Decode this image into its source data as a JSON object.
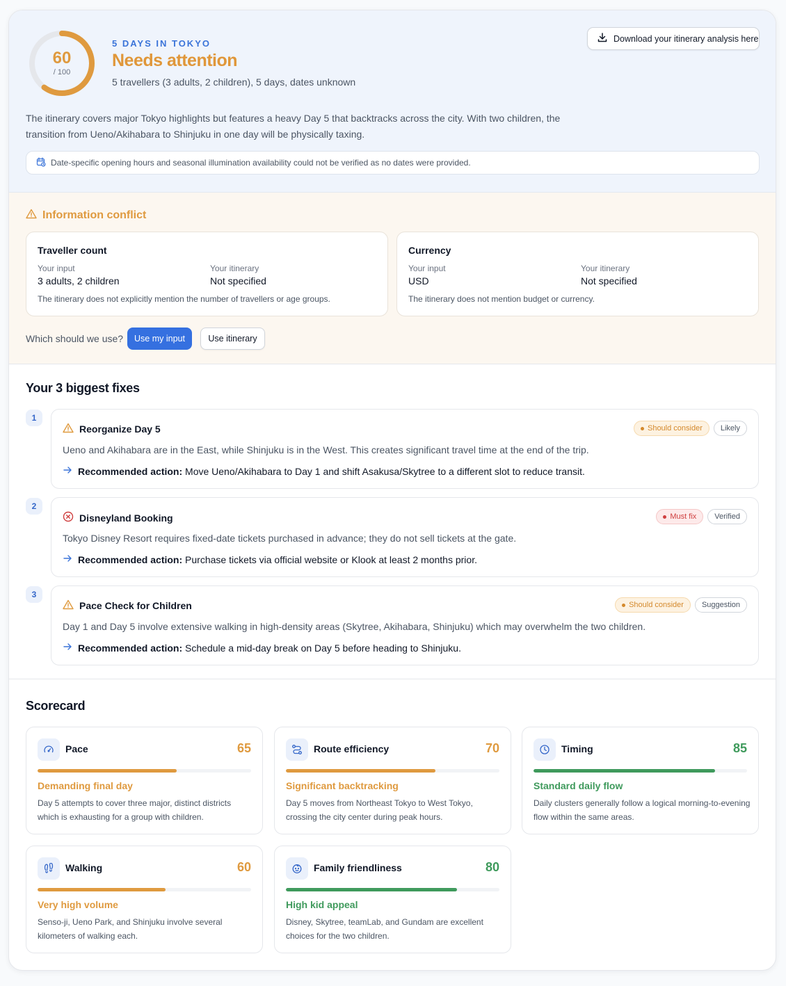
{
  "hero": {
    "score": "60",
    "score_value": 60,
    "score_out_of": "/ 100",
    "eyebrow": "5 DAYS IN TOKYO",
    "status": "Needs attention",
    "meta": "5 travellers (3 adults, 2 children), 5 days, dates unknown",
    "download_label": "Download your itinerary analysis here",
    "summary": "The itinerary covers major Tokyo highlights but features a heavy Day 5 that backtracks across the city. With two children, the transition from Ueno/Akihabara to Shinjuku in one day will be physically taxing.",
    "notice": "Date-specific opening hours and seasonal illumination availability could not be verified as no dates were provided.",
    "accent": "#df9a3f"
  },
  "conflict": {
    "title": "Information conflict",
    "boxes": [
      {
        "title": "Traveller count",
        "input_label": "Your input",
        "input_value": "3 adults, 2 children",
        "itinerary_label": "Your itinerary",
        "itinerary_value": "Not specified",
        "note": "The itinerary does not explicitly mention the number of travellers or age groups."
      },
      {
        "title": "Currency",
        "input_label": "Your input",
        "input_value": "USD",
        "itinerary_label": "Your itinerary",
        "itinerary_value": "Not specified",
        "note": "The itinerary does not mention budget or currency."
      }
    ],
    "question": "Which should we use?",
    "use_input_label": "Use my input",
    "use_itinerary_label": "Use itinerary"
  },
  "fixes": {
    "title": "Your 3 biggest fixes",
    "action_prefix": "Recommended action:",
    "items": [
      {
        "num": "1",
        "title": "Reorganize Day 5",
        "icon": "warning-icon",
        "severity": "Should consider",
        "confidence": "Likely",
        "body": "Ueno and Akihabara are in the East, while Shinjuku is in the West. This creates significant travel time at the end of the trip.",
        "action": "Move Ueno/Akihabara to Day 1 and shift Asakusa/Skytree to a different slot to reduce transit."
      },
      {
        "num": "2",
        "title": "Disneyland Booking",
        "icon": "error-icon",
        "severity": "Must fix",
        "confidence": "Verified",
        "body": "Tokyo Disney Resort requires fixed-date tickets purchased in advance; they do not sell tickets at the gate.",
        "action": "Purchase tickets via official website or Klook at least 2 months prior."
      },
      {
        "num": "3",
        "title": "Pace Check for Children",
        "icon": "warning-icon",
        "severity": "Should consider",
        "confidence": "Suggestion",
        "body": "Day 1 and Day 5 involve extensive walking in high-density areas (Skytree, Akihabara, Shinjuku) which may overwhelm the two children.",
        "action": "Schedule a mid-day break on Day 5 before heading to Shinjuku."
      }
    ]
  },
  "scorecard": {
    "title": "Scorecard",
    "items": [
      {
        "name": "Pace",
        "icon": "gauge-icon",
        "value": "65",
        "fill": 65,
        "color": "#df9a3f",
        "subtitle": "Demanding final day",
        "desc": "Day 5 attempts to cover three major, distinct districts which is exhausting for a group with children."
      },
      {
        "name": "Route efficiency",
        "icon": "route-icon",
        "value": "70",
        "fill": 70,
        "color": "#df9a3f",
        "subtitle": "Significant backtracking",
        "desc": "Day 5 moves from Northeast Tokyo to West Tokyo, crossing the city center during peak hours."
      },
      {
        "name": "Timing",
        "icon": "clock-icon",
        "value": "85",
        "fill": 85,
        "color": "#3f9a5c",
        "subtitle": "Standard daily flow",
        "desc": "Daily clusters generally follow a logical morning-to-evening flow within the same areas."
      },
      {
        "name": "Walking",
        "icon": "footprints-icon",
        "value": "60",
        "fill": 60,
        "color": "#df9a3f",
        "subtitle": "Very high volume",
        "desc": "Senso-ji, Ueno Park, and Shinjuku involve several kilometers of walking each."
      },
      {
        "name": "Family friendliness",
        "icon": "baby-face-icon",
        "value": "80",
        "fill": 80,
        "color": "#3f9a5c",
        "subtitle": "High kid appeal",
        "desc": "Disney, Skytree, teamLab, and Gundam are excellent choices for the two children."
      }
    ]
  }
}
